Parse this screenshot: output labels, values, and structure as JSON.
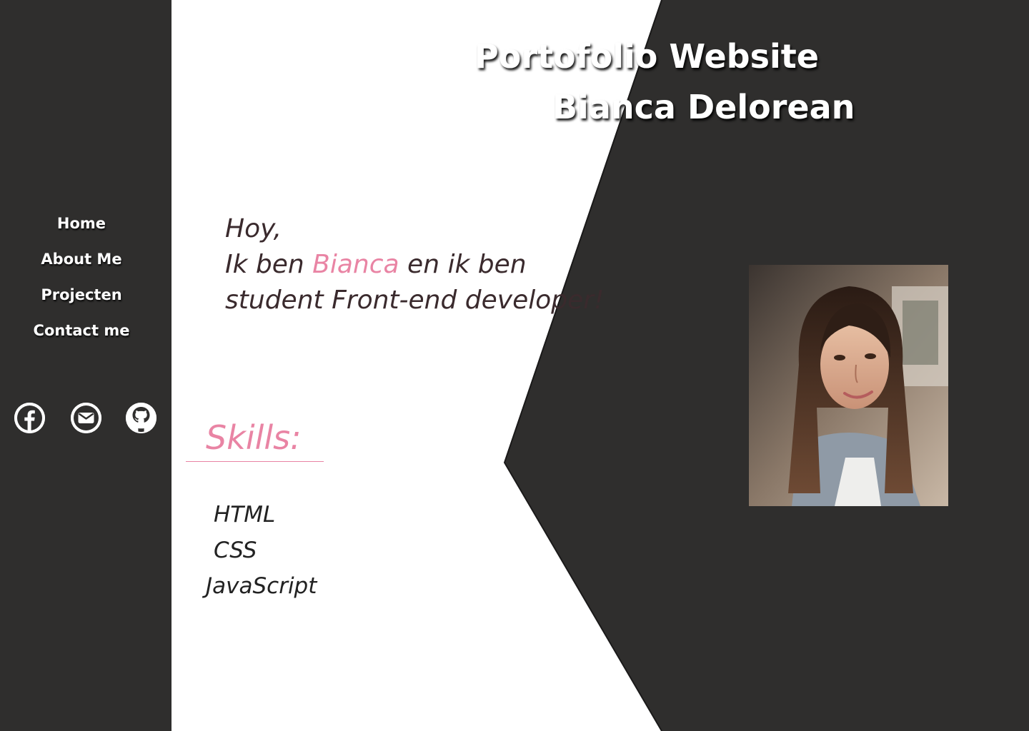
{
  "header": {
    "title": "Portofolio Website",
    "name": "Bianca Delorean"
  },
  "nav": {
    "items": [
      {
        "label": "Home"
      },
      {
        "label": "About Me"
      },
      {
        "label": "Projecten"
      },
      {
        "label": "Contact me"
      }
    ]
  },
  "socials": [
    {
      "icon": "facebook-icon"
    },
    {
      "icon": "mail-icon"
    },
    {
      "icon": "github-icon"
    }
  ],
  "intro": {
    "line1": "Hoy,",
    "line2_prefix": "Ik ben ",
    "line2_name": "Bianca",
    "line2_suffix": " en ik ben",
    "line3": "student Front-end developer!"
  },
  "skills": {
    "heading": "Skills:",
    "items": [
      "HTML",
      "CSS",
      "JavaScript"
    ]
  },
  "colors": {
    "background_dark": "#2f2e2d",
    "background_light": "#ffffff",
    "accent_pink": "#e984a4",
    "text_dark": "#3a2a2d"
  }
}
